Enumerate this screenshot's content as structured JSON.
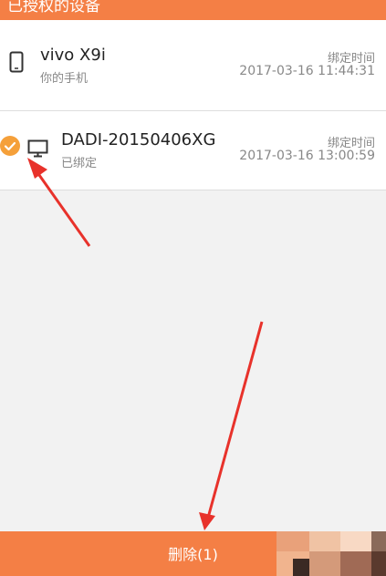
{
  "header": {
    "title": "已授权的设备"
  },
  "devices": [
    {
      "name": "vivo X9i",
      "subtitle": "你的手机",
      "time_label": "绑定时间",
      "time": "2017-03-16 11:44:31",
      "icon": "phone-icon",
      "selected": false
    },
    {
      "name": "DADI-20150406XG",
      "subtitle": "已绑定",
      "time_label": "绑定时间",
      "time": "2017-03-16 13:00:59",
      "icon": "monitor-icon",
      "selected": true
    }
  ],
  "footer": {
    "delete_label": "删除(1)"
  },
  "colors": {
    "accent": "#f47f45",
    "check": "#f5a03a",
    "arrow": "#e8322b"
  }
}
